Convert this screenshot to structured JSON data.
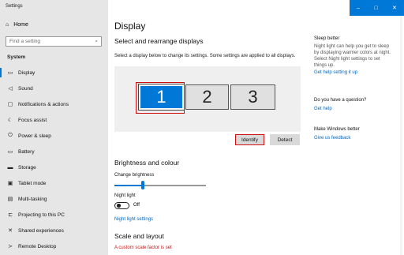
{
  "app": {
    "title": "Settings"
  },
  "window_controls": {
    "minimize": "–",
    "maximize": "□",
    "close": "✕"
  },
  "sidebar": {
    "home": "Home",
    "search_placeholder": "Find a setting",
    "section": "System",
    "items": [
      {
        "label": "Display",
        "icon": "monitor-icon",
        "selected": true
      },
      {
        "label": "Sound",
        "icon": "speaker-icon"
      },
      {
        "label": "Notifications & actions",
        "icon": "notification-icon"
      },
      {
        "label": "Focus assist",
        "icon": "moon-icon"
      },
      {
        "label": "Power & sleep",
        "icon": "power-icon"
      },
      {
        "label": "Battery",
        "icon": "battery-icon"
      },
      {
        "label": "Storage",
        "icon": "storage-icon"
      },
      {
        "label": "Tablet mode",
        "icon": "tablet-icon"
      },
      {
        "label": "Multi-tasking",
        "icon": "multitask-icon"
      },
      {
        "label": "Projecting to this PC",
        "icon": "projector-icon"
      },
      {
        "label": "Shared experiences",
        "icon": "share-icon"
      },
      {
        "label": "Remote Desktop",
        "icon": "remote-icon"
      }
    ]
  },
  "main": {
    "title": "Display",
    "arrange_heading": "Select and rearrange displays",
    "arrange_desc": "Select a display below to change its settings. Some settings are applied to all displays.",
    "monitors": [
      "1",
      "2",
      "3"
    ],
    "identify_label": "Identify",
    "detect_label": "Detect",
    "brightness_heading": "Brightness and colour",
    "brightness_label": "Change brightness",
    "brightness_value": 0.3,
    "night_light_label": "Night light",
    "night_light_state": "Off",
    "night_light_settings": "Night light settings",
    "scale_heading": "Scale and layout",
    "scale_warning": "A custom scale factor is set"
  },
  "right": {
    "sleep_title": "Sleep better",
    "sleep_text": "Night light can help you get to sleep by displaying warmer colors at night. Select Night light settings to set things up.",
    "sleep_link": "Get help setting it up",
    "question_title": "Do you have a question?",
    "question_link": "Get help",
    "better_title": "Make Windows better",
    "better_link": "Give us feedback"
  }
}
